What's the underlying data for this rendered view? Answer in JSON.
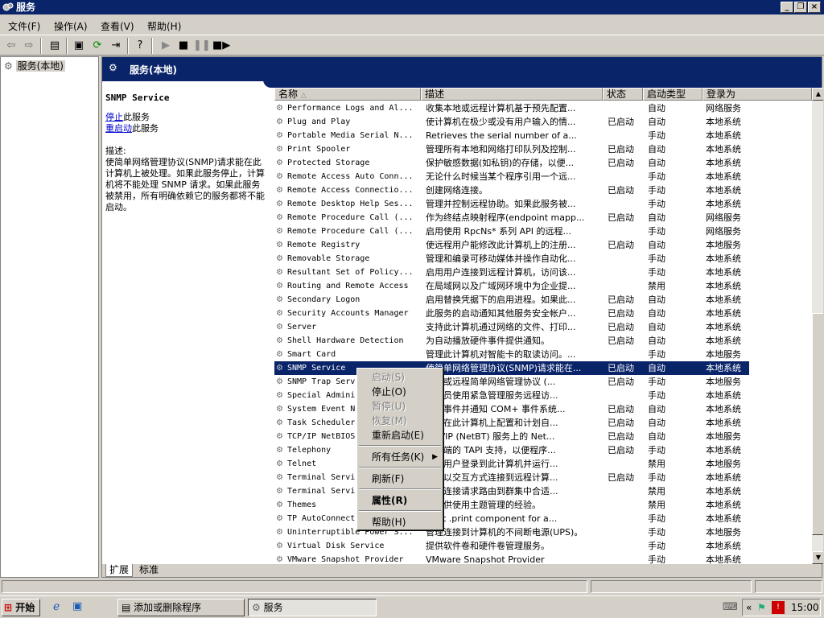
{
  "window": {
    "title": "服务"
  },
  "menu": [
    "文件(F)",
    "操作(A)",
    "查看(V)",
    "帮助(H)"
  ],
  "tree": {
    "root": "服务(本地)"
  },
  "banner": {
    "title": "服务(本地)"
  },
  "detail": {
    "service_name": "SNMP Service",
    "stop_link": "停止",
    "stop_suffix": "此服务",
    "restart_link": "重启动",
    "restart_suffix": "此服务",
    "desc_label": "描述:",
    "description": "使简单网络管理协议(SNMP)请求能在此计算机上被处理。如果此服务停止，计算机将不能处理 SNMP 请求。如果此服务被禁用，所有明确依赖它的服务都将不能启动。"
  },
  "columns": [
    "名称",
    "描述",
    "状态",
    "启动类型",
    "登录为"
  ],
  "services": [
    {
      "name": "Performance Logs and Al...",
      "desc": "收集本地或远程计算机基于预先配置...",
      "status": "",
      "startup": "自动",
      "logon": "网络服务"
    },
    {
      "name": "Plug and Play",
      "desc": "使计算机在极少或没有用户输入的情...",
      "status": "已启动",
      "startup": "自动",
      "logon": "本地系统"
    },
    {
      "name": "Portable Media Serial N...",
      "desc": "Retrieves the serial number of a...",
      "status": "",
      "startup": "手动",
      "logon": "本地系统"
    },
    {
      "name": "Print Spooler",
      "desc": "管理所有本地和网络打印队列及控制...",
      "status": "已启动",
      "startup": "自动",
      "logon": "本地系统"
    },
    {
      "name": "Protected Storage",
      "desc": "保护敏感数据(如私钥)的存储，以便...",
      "status": "已启动",
      "startup": "自动",
      "logon": "本地系统"
    },
    {
      "name": "Remote Access Auto Conn...",
      "desc": "无论什么时候当某个程序引用一个远...",
      "status": "",
      "startup": "手动",
      "logon": "本地系统"
    },
    {
      "name": "Remote Access Connectio...",
      "desc": "创建网络连接。",
      "status": "已启动",
      "startup": "手动",
      "logon": "本地系统"
    },
    {
      "name": "Remote Desktop Help Ses...",
      "desc": "管理并控制远程协助。如果此服务被...",
      "status": "",
      "startup": "手动",
      "logon": "本地系统"
    },
    {
      "name": "Remote Procedure Call (...",
      "desc": "作为终结点映射程序(endpoint mapp...",
      "status": "已启动",
      "startup": "自动",
      "logon": "网络服务"
    },
    {
      "name": "Remote Procedure Call (...",
      "desc": "启用使用 RpcNs* 系列 API 的远程...",
      "status": "",
      "startup": "手动",
      "logon": "网络服务"
    },
    {
      "name": "Remote Registry",
      "desc": "使远程用户能修改此计算机上的注册...",
      "status": "已启动",
      "startup": "自动",
      "logon": "本地服务"
    },
    {
      "name": "Removable Storage",
      "desc": "管理和编录可移动媒体并操作自动化...",
      "status": "",
      "startup": "手动",
      "logon": "本地系统"
    },
    {
      "name": "Resultant Set of Policy...",
      "desc": "启用用户连接到远程计算机，访问该...",
      "status": "",
      "startup": "手动",
      "logon": "本地系统"
    },
    {
      "name": "Routing and Remote Access",
      "desc": "在局域网以及广域网环境中为企业提...",
      "status": "",
      "startup": "禁用",
      "logon": "本地系统"
    },
    {
      "name": "Secondary Logon",
      "desc": "启用替换凭据下的启用进程。如果此...",
      "status": "已启动",
      "startup": "自动",
      "logon": "本地系统"
    },
    {
      "name": "Security Accounts Manager",
      "desc": "此服务的启动通知其他服务安全帐户...",
      "status": "已启动",
      "startup": "自动",
      "logon": "本地系统"
    },
    {
      "name": "Server",
      "desc": "支持此计算机通过网络的文件、打印...",
      "status": "已启动",
      "startup": "自动",
      "logon": "本地系统"
    },
    {
      "name": "Shell Hardware Detection",
      "desc": "为自动播放硬件事件提供通知。",
      "status": "已启动",
      "startup": "自动",
      "logon": "本地系统"
    },
    {
      "name": "Smart Card",
      "desc": "管理此计算机对智能卡的取读访问。...",
      "status": "",
      "startup": "手动",
      "logon": "本地服务"
    },
    {
      "name": "SNMP Service",
      "desc": "使简单网络管理协议(SNMP)请求能在...",
      "status": "已启动",
      "startup": "自动",
      "logon": "本地系统",
      "selected": true
    },
    {
      "name": "SNMP Trap Serv",
      "desc": "本地或远程简单网络管理协议 (...",
      "status": "已启动",
      "startup": "手动",
      "logon": "本地服务"
    },
    {
      "name": "Special Admini",
      "desc": "管理员使用紧急管理服务远程访...",
      "status": "",
      "startup": "手动",
      "logon": "本地系统"
    },
    {
      "name": "System Event N",
      "desc": "系统事件并通知 COM+ 事件系统...",
      "status": "已启动",
      "startup": "自动",
      "logon": "本地系统"
    },
    {
      "name": "Task Scheduler",
      "desc": "户能在此计算机上配置和计划自...",
      "status": "已启动",
      "startup": "自动",
      "logon": "本地系统"
    },
    {
      "name": "TCP/IP NetBIOS",
      "desc": "TCP/IP (NetBT) 服务上的 Net...",
      "status": "已启动",
      "startup": "自动",
      "logon": "本地服务"
    },
    {
      "name": "Telephony",
      "desc": "客户端的 TAPI 支持，以便程序...",
      "status": "已启动",
      "startup": "手动",
      "logon": "本地系统"
    },
    {
      "name": "Telnet",
      "desc": "远程用户登录到此计算机并运行...",
      "status": "",
      "startup": "禁用",
      "logon": "本地服务"
    },
    {
      "name": "Terminal Servi",
      "desc": "用户以交互方式连接到远程计算...",
      "status": "已启动",
      "startup": "手动",
      "logon": "本地系统"
    },
    {
      "name": "Terminal Servi",
      "desc": "用户连接请求路由到群集中合适...",
      "status": "",
      "startup": "禁用",
      "logon": "本地系统"
    },
    {
      "name": "Themes",
      "desc": "户提供使用主题管理的经验。",
      "status": "",
      "startup": "禁用",
      "logon": "本地系统"
    },
    {
      "name": "TP AutoConnect",
      "desc": "Print .print component for a...",
      "status": "",
      "startup": "手动",
      "logon": "本地系统"
    },
    {
      "name": "Uninterruptible Power S...",
      "desc": "管理连接到计算机的不间断电源(UPS)。",
      "status": "",
      "startup": "手动",
      "logon": "本地服务"
    },
    {
      "name": "Virtual Disk Service",
      "desc": "提供软件卷和硬件卷管理服务。",
      "status": "",
      "startup": "手动",
      "logon": "本地系统"
    },
    {
      "name": "VMware Snapshot Provider",
      "desc": "VMware Snapshot Provider",
      "status": "",
      "startup": "手动",
      "logon": "本地系统"
    }
  ],
  "context_menu": {
    "start": "启动(S)",
    "stop": "停止(O)",
    "pause": "暂停(U)",
    "resume": "恢复(M)",
    "restart": "重新启动(E)",
    "all_tasks": "所有任务(K)",
    "refresh": "刷新(F)",
    "properties": "属性(R)",
    "help": "帮助(H)"
  },
  "tabs": [
    "扩展",
    "标准"
  ],
  "taskbar": {
    "start": "开始",
    "tasks": [
      "添加或删除程序",
      "服务"
    ],
    "clock": "15:00"
  }
}
